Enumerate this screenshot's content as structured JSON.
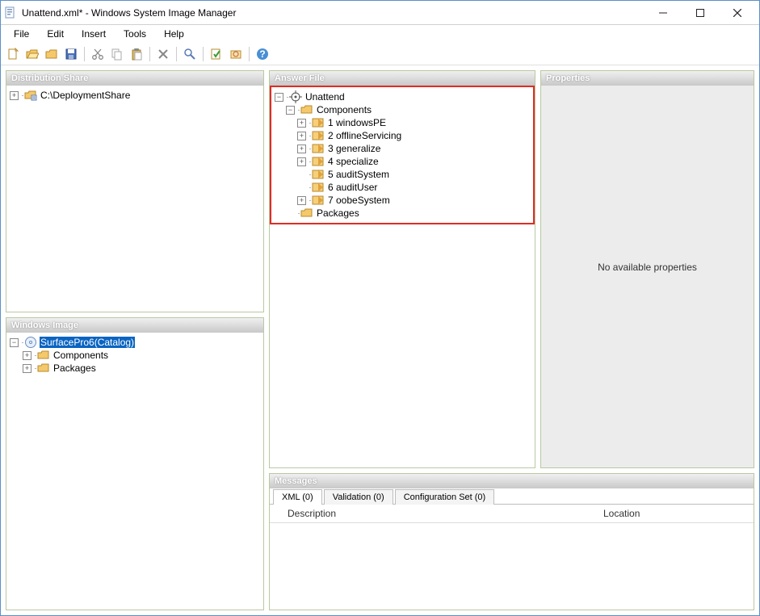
{
  "title": "Unattend.xml* - Windows System Image Manager",
  "menus": {
    "file": "File",
    "edit": "Edit",
    "insert": "Insert",
    "tools": "Tools",
    "help": "Help"
  },
  "panels": {
    "distribution": {
      "header": "Distribution Share",
      "root": "C:\\DeploymentShare"
    },
    "windowsImage": {
      "header": "Windows Image",
      "root": "SurfacePro6(Catalog)",
      "children": {
        "components": "Components",
        "packages": "Packages"
      }
    },
    "answerFile": {
      "header": "Answer File",
      "root": "Unattend",
      "componentsLabel": "Components",
      "packagesLabel": "Packages",
      "passes": {
        "p1": "1 windowsPE",
        "p2": "2 offlineServicing",
        "p3": "3 generalize",
        "p4": "4 specialize",
        "p5": "5 auditSystem",
        "p6": "6 auditUser",
        "p7": "7 oobeSystem"
      }
    },
    "properties": {
      "header": "Properties",
      "empty": "No available properties"
    },
    "messages": {
      "header": "Messages",
      "tabs": {
        "xml": "XML (0)",
        "validation": "Validation (0)",
        "config": "Configuration Set (0)"
      },
      "cols": {
        "desc": "Description",
        "loc": "Location"
      }
    }
  }
}
